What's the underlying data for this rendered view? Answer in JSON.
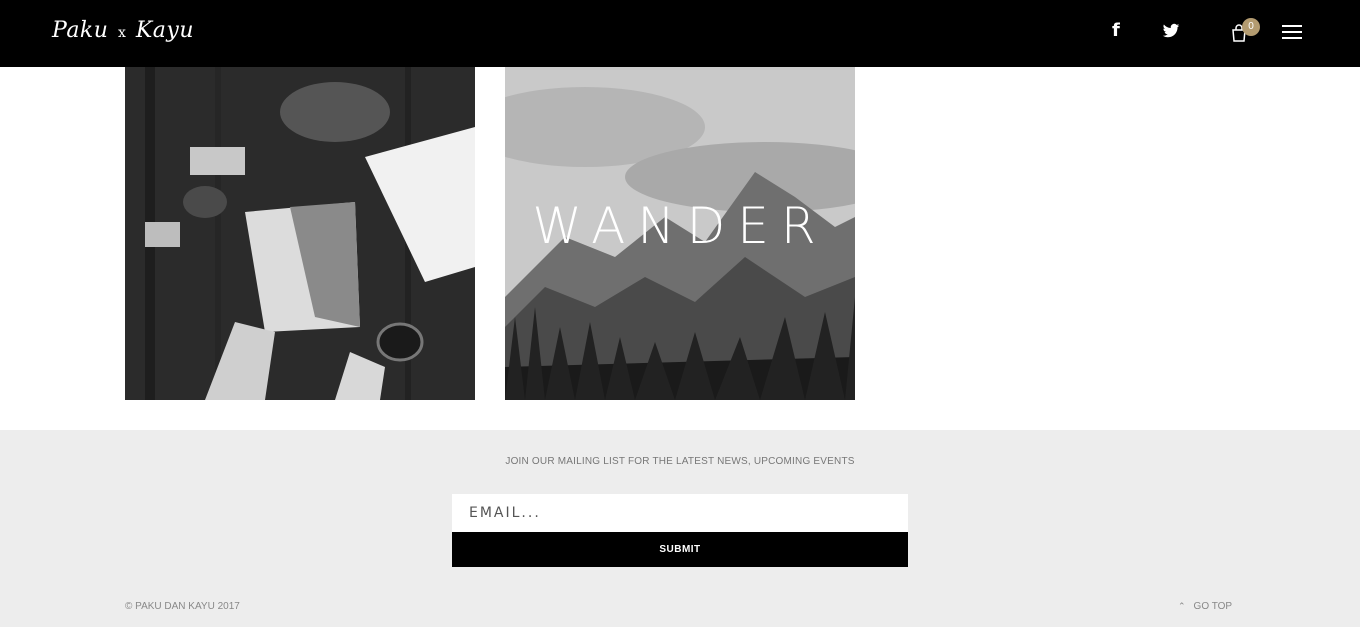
{
  "header": {
    "logo": {
      "word1": "Paku",
      "separator": "x",
      "word2": "Kayu"
    },
    "facebook_icon_glyph": "f",
    "cart_count": "0",
    "icons": [
      "facebook-icon",
      "twitter-icon",
      "cart-icon",
      "menu-icon"
    ]
  },
  "gallery": {
    "items": [
      {
        "image": "desk-reading-photo",
        "overlay_text": ""
      },
      {
        "image": "mountain-forest-photo",
        "overlay_text": "WANDER"
      }
    ]
  },
  "footer": {
    "mailing_label": "JOIN OUR MAILING LIST FOR THE LATEST NEWS, UPCOMING EVENTS",
    "email_placeholder": "EMAIL...",
    "submit_label": "SUBMIT",
    "copyright": "© PAKU DAN KAYU 2017",
    "go_top_label": "GO TOP"
  },
  "colors": {
    "header_bg": "#000000",
    "footer_bg": "#ededed",
    "badge": "#b39b70"
  }
}
